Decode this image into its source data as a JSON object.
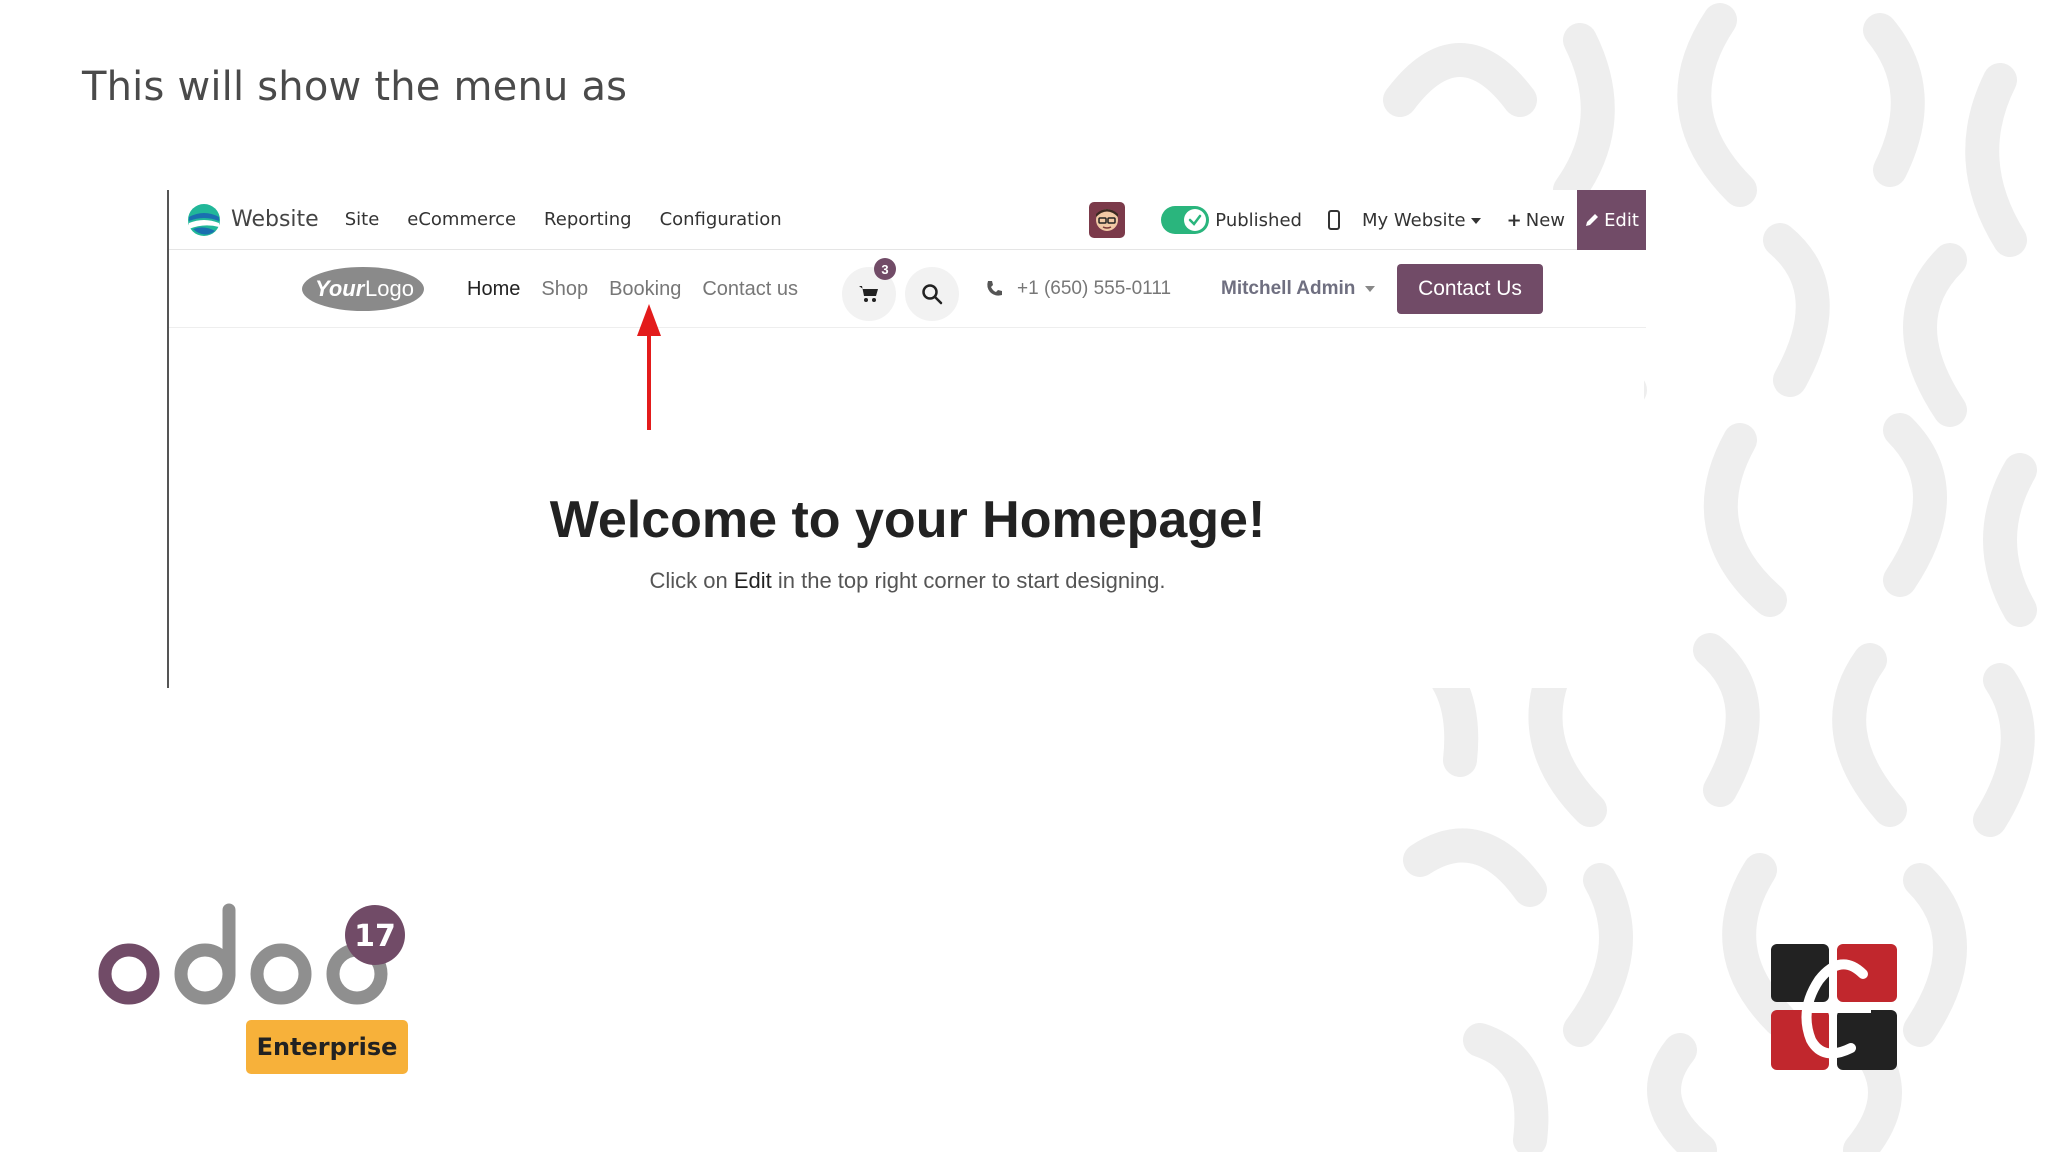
{
  "slide": {
    "title": "This will show the menu as"
  },
  "admin_bar": {
    "brand": "Website",
    "menu": [
      "Site",
      "eCommerce",
      "Reporting",
      "Configuration"
    ],
    "published_label": "Published",
    "my_website_label": "My Website",
    "new_label": "New",
    "edit_label": "Edit",
    "colors": {
      "accent": "#714b67",
      "toggle_on": "#2ab57d"
    }
  },
  "site_header": {
    "menu": [
      {
        "label": "Home",
        "active": true
      },
      {
        "label": "Shop",
        "active": false
      },
      {
        "label": "Booking",
        "active": false
      },
      {
        "label": "Contact us",
        "active": false
      }
    ],
    "cart_count": "3",
    "phone": "+1 (650) 555-0111",
    "user": "Mitchell Admin",
    "contact_button": "Contact Us"
  },
  "content": {
    "welcome_prefix": "Welcome to your ",
    "welcome_bold": "Homepage",
    "welcome_suffix": "!",
    "sub_prefix": "Click on ",
    "sub_bold": "Edit",
    "sub_suffix": " in the top right corner to start designing."
  },
  "branding": {
    "version": "17",
    "edition": "Enterprise"
  },
  "icons": {
    "brand": "website-icon",
    "cart": "cart-icon",
    "search": "search-icon",
    "phone": "phone-icon",
    "edit": "pencil-icon",
    "mobile": "mobile-preview-icon"
  }
}
